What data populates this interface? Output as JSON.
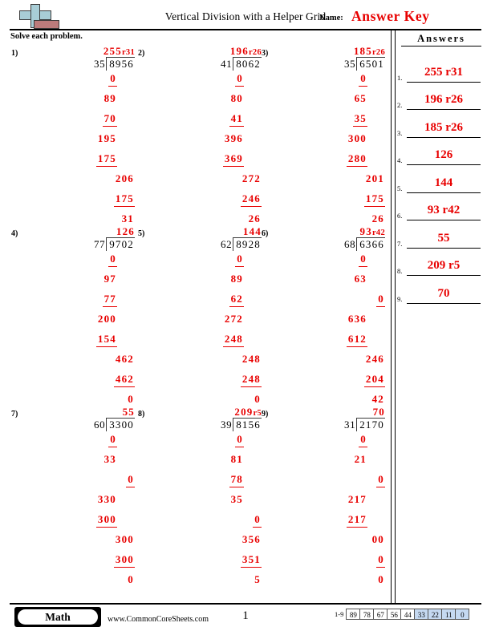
{
  "header": {
    "title": "Vertical Division with a Helper Grid",
    "name_label": "Name:",
    "answer_key": "Answer Key",
    "logo_icon": "plus-block-logo"
  },
  "instructions": "Solve each problem.",
  "answers_panel": {
    "heading": "Answers",
    "items": [
      {
        "number": "1.",
        "value": "255 r31"
      },
      {
        "number": "2.",
        "value": "196 r26"
      },
      {
        "number": "3.",
        "value": "185 r26"
      },
      {
        "number": "4.",
        "value": "126"
      },
      {
        "number": "5.",
        "value": "144"
      },
      {
        "number": "6.",
        "value": "93 r42"
      },
      {
        "number": "7.",
        "value": "55"
      },
      {
        "number": "8.",
        "value": "209 r5"
      },
      {
        "number": "9.",
        "value": "70"
      }
    ]
  },
  "problems": [
    {
      "number": "1)",
      "divisor": "35",
      "dividend": "8956",
      "quotient": "255",
      "remainder": "r31",
      "steps": [
        {
          "text": "0",
          "underline": true,
          "indent": 0
        },
        {
          "text": "89",
          "underline": false,
          "indent": 0
        },
        {
          "text": "70",
          "underline": true,
          "indent": 0
        },
        {
          "text": "195",
          "underline": false,
          "indent": 0
        },
        {
          "text": "175",
          "underline": true,
          "indent": 0
        },
        {
          "text": "206",
          "underline": false,
          "indent": 1
        },
        {
          "text": "175",
          "underline": true,
          "indent": 1
        },
        {
          "text": "31",
          "underline": false,
          "indent": 1
        }
      ]
    },
    {
      "number": "2)",
      "divisor": "41",
      "dividend": "8062",
      "quotient": "196",
      "remainder": "r26",
      "steps": [
        {
          "text": "0",
          "underline": true,
          "indent": 0
        },
        {
          "text": "80",
          "underline": false,
          "indent": 0
        },
        {
          "text": "41",
          "underline": true,
          "indent": 0
        },
        {
          "text": "396",
          "underline": false,
          "indent": 0
        },
        {
          "text": "369",
          "underline": true,
          "indent": 0
        },
        {
          "text": "272",
          "underline": false,
          "indent": 1
        },
        {
          "text": "246",
          "underline": true,
          "indent": 1
        },
        {
          "text": "26",
          "underline": false,
          "indent": 1
        }
      ]
    },
    {
      "number": "3)",
      "divisor": "35",
      "dividend": "6501",
      "quotient": "185",
      "remainder": "r26",
      "steps": [
        {
          "text": "0",
          "underline": true,
          "indent": 0
        },
        {
          "text": "65",
          "underline": false,
          "indent": 0
        },
        {
          "text": "35",
          "underline": true,
          "indent": 0
        },
        {
          "text": "300",
          "underline": false,
          "indent": 0
        },
        {
          "text": "280",
          "underline": true,
          "indent": 0
        },
        {
          "text": "201",
          "underline": false,
          "indent": 1
        },
        {
          "text": "175",
          "underline": true,
          "indent": 1
        },
        {
          "text": "26",
          "underline": false,
          "indent": 1
        }
      ]
    },
    {
      "number": "4)",
      "divisor": "77",
      "dividend": "9702",
      "quotient": "126",
      "remainder": "",
      "steps": [
        {
          "text": "0",
          "underline": true,
          "indent": 0
        },
        {
          "text": "97",
          "underline": false,
          "indent": 0
        },
        {
          "text": "77",
          "underline": true,
          "indent": 0
        },
        {
          "text": "200",
          "underline": false,
          "indent": 0
        },
        {
          "text": "154",
          "underline": true,
          "indent": 0
        },
        {
          "text": "462",
          "underline": false,
          "indent": 1
        },
        {
          "text": "462",
          "underline": true,
          "indent": 1
        },
        {
          "text": "0",
          "underline": false,
          "indent": 1
        }
      ]
    },
    {
      "number": "5)",
      "divisor": "62",
      "dividend": "8928",
      "quotient": "144",
      "remainder": "",
      "steps": [
        {
          "text": "0",
          "underline": true,
          "indent": 0
        },
        {
          "text": "89",
          "underline": false,
          "indent": 0
        },
        {
          "text": "62",
          "underline": true,
          "indent": 0
        },
        {
          "text": "272",
          "underline": false,
          "indent": 0
        },
        {
          "text": "248",
          "underline": true,
          "indent": 0
        },
        {
          "text": "248",
          "underline": false,
          "indent": 1
        },
        {
          "text": "248",
          "underline": true,
          "indent": 1
        },
        {
          "text": "0",
          "underline": false,
          "indent": 1
        }
      ]
    },
    {
      "number": "6)",
      "divisor": "68",
      "dividend": "6366",
      "quotient": "93",
      "remainder": "r42",
      "steps": [
        {
          "text": "0",
          "underline": true,
          "indent": 0
        },
        {
          "text": "63",
          "underline": false,
          "indent": 0
        },
        {
          "text": "0",
          "underline": true,
          "indent": 1
        },
        {
          "text": "636",
          "underline": false,
          "indent": 0
        },
        {
          "text": "612",
          "underline": true,
          "indent": 0
        },
        {
          "text": "246",
          "underline": false,
          "indent": 1
        },
        {
          "text": "204",
          "underline": true,
          "indent": 1
        },
        {
          "text": "42",
          "underline": false,
          "indent": 1
        }
      ]
    },
    {
      "number": "7)",
      "divisor": "60",
      "dividend": "3300",
      "quotient": "55",
      "remainder": "",
      "steps": [
        {
          "text": "0",
          "underline": true,
          "indent": 0
        },
        {
          "text": "33",
          "underline": false,
          "indent": 0
        },
        {
          "text": "0",
          "underline": true,
          "indent": 1
        },
        {
          "text": "330",
          "underline": false,
          "indent": 0
        },
        {
          "text": "300",
          "underline": true,
          "indent": 0
        },
        {
          "text": "300",
          "underline": false,
          "indent": 1
        },
        {
          "text": "300",
          "underline": true,
          "indent": 1
        },
        {
          "text": "0",
          "underline": false,
          "indent": 1
        }
      ]
    },
    {
      "number": "8)",
      "divisor": "39",
      "dividend": "8156",
      "quotient": "209",
      "remainder": "r5",
      "steps": [
        {
          "text": "0",
          "underline": true,
          "indent": 0
        },
        {
          "text": "81",
          "underline": false,
          "indent": 0
        },
        {
          "text": "78",
          "underline": true,
          "indent": 0
        },
        {
          "text": "35",
          "underline": false,
          "indent": 0
        },
        {
          "text": "0",
          "underline": true,
          "indent": 1
        },
        {
          "text": "356",
          "underline": false,
          "indent": 1
        },
        {
          "text": "351",
          "underline": true,
          "indent": 1
        },
        {
          "text": "5",
          "underline": false,
          "indent": 1
        }
      ]
    },
    {
      "number": "9)",
      "divisor": "31",
      "dividend": "2170",
      "quotient": "70",
      "remainder": "",
      "steps": [
        {
          "text": "0",
          "underline": true,
          "indent": 0
        },
        {
          "text": "21",
          "underline": false,
          "indent": 0
        },
        {
          "text": "0",
          "underline": true,
          "indent": 1
        },
        {
          "text": "217",
          "underline": false,
          "indent": 0
        },
        {
          "text": "217",
          "underline": true,
          "indent": 0
        },
        {
          "text": "00",
          "underline": false,
          "indent": 1
        },
        {
          "text": "0",
          "underline": true,
          "indent": 1
        },
        {
          "text": "0",
          "underline": false,
          "indent": 1
        }
      ]
    }
  ],
  "footer": {
    "subject_badge": "Math",
    "site_url": "www.CommonCoreSheets.com",
    "page_number": "1",
    "scale_label": "1-9",
    "scale_values": [
      {
        "value": "89",
        "highlighted": false
      },
      {
        "value": "78",
        "highlighted": false
      },
      {
        "value": "67",
        "highlighted": false
      },
      {
        "value": "56",
        "highlighted": false
      },
      {
        "value": "44",
        "highlighted": false
      },
      {
        "value": "33",
        "highlighted": true
      },
      {
        "value": "22",
        "highlighted": true
      },
      {
        "value": "11",
        "highlighted": true
      },
      {
        "value": "0",
        "highlighted": true
      }
    ]
  },
  "colors": {
    "answer_red": "#e80000",
    "logo_blue": "#a8cdd6",
    "logo_red": "#bc7b7b",
    "scale_highlight": "#c5d9f1"
  }
}
